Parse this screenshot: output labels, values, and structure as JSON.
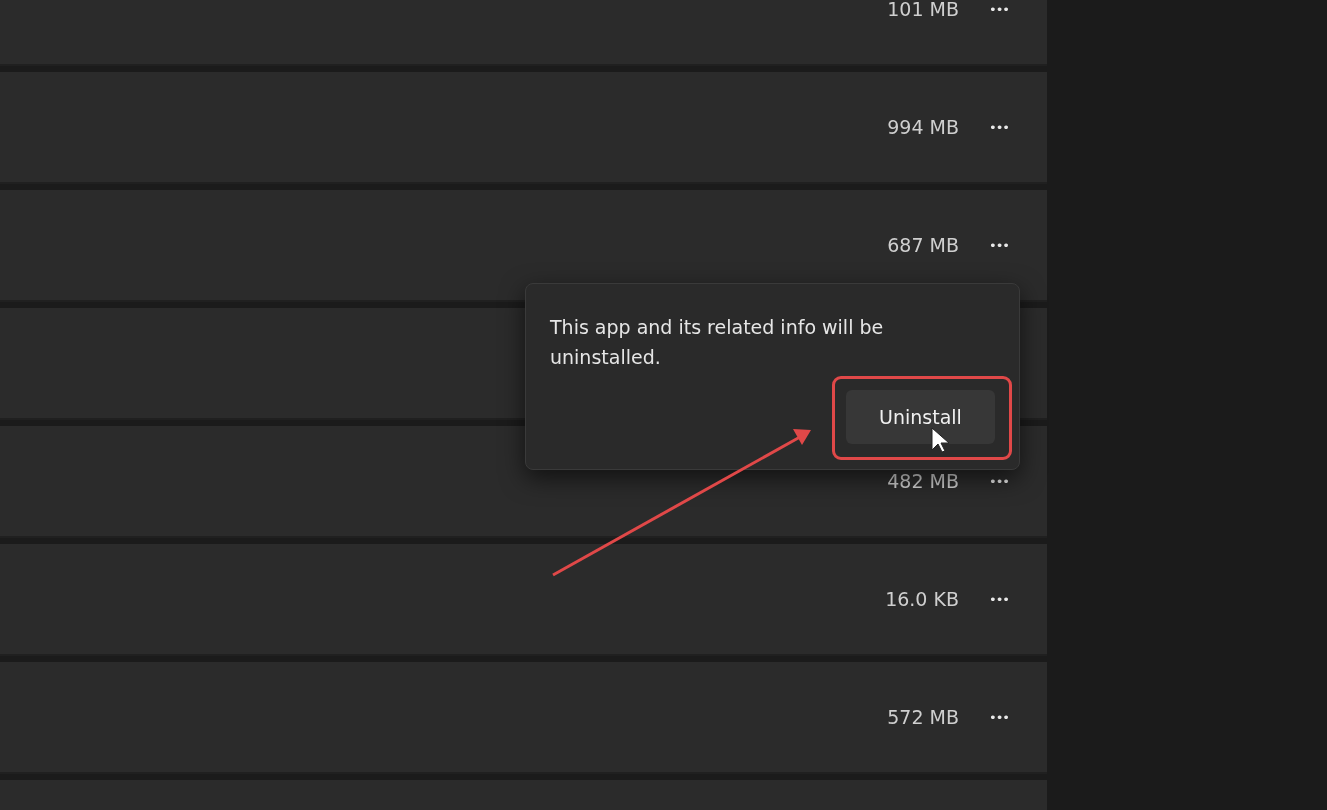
{
  "app_rows": [
    {
      "size": "101 MB",
      "more": "•••"
    },
    {
      "size": "994 MB",
      "more": "•••"
    },
    {
      "size": "687 MB",
      "more": "•••"
    },
    {},
    {
      "size": "482 MB",
      "more": "•••"
    },
    {
      "size": "16.0 KB",
      "more": "•••"
    },
    {
      "size": "572 MB",
      "more": "•••"
    },
    {}
  ],
  "flyout": {
    "message": "This app and its related info will be uninstalled.",
    "button": "Uninstall"
  },
  "annotation": {
    "highlight_box": true,
    "arrow": true
  }
}
